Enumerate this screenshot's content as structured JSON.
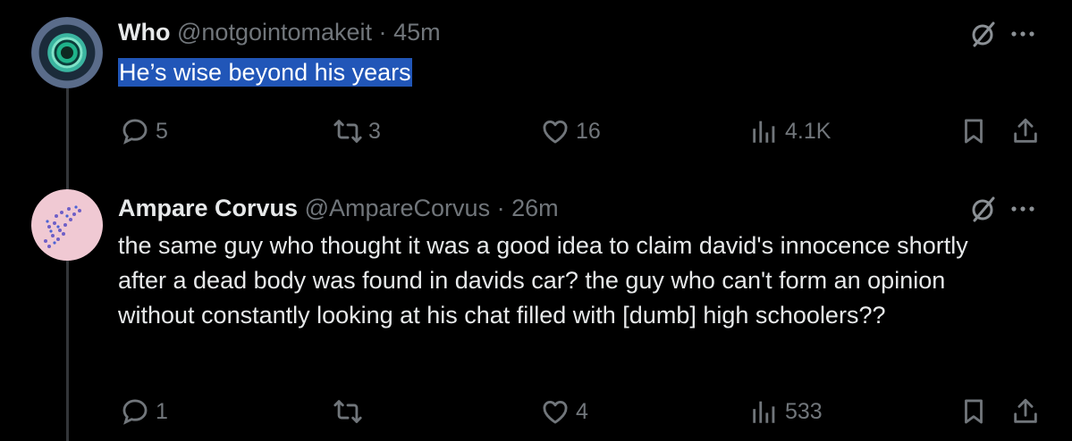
{
  "posts": [
    {
      "name": "Who",
      "handle": "@notgointomakeit",
      "sep": "·",
      "time": "45m",
      "text": "He’s wise beyond his years",
      "replies": "5",
      "reposts": "3",
      "likes": "16",
      "views": "4.1K"
    },
    {
      "name": "Ampare Corvus",
      "handle": "@AmpareCorvus",
      "sep": "·",
      "time": "26m",
      "text": "the same guy who thought it was a good idea to claim david's innocence shortly after a dead body was found in davids car? the guy who can't form an opinion without constantly looking at his chat filled with [dumb] high schoolers??",
      "replies": "1",
      "reposts": "",
      "likes": "4",
      "views": "533"
    }
  ],
  "icons": {
    "reply": "reply-icon",
    "repost": "repost-icon",
    "like": "heart-icon",
    "views": "views-icon",
    "bookmark": "bookmark-icon",
    "share": "share-icon",
    "grok": "grok-icon",
    "more": "more-icon"
  },
  "colors": {
    "background": "#000000",
    "text": "#e7e9ea",
    "muted": "#71767b",
    "highlight": "#2156b8"
  }
}
